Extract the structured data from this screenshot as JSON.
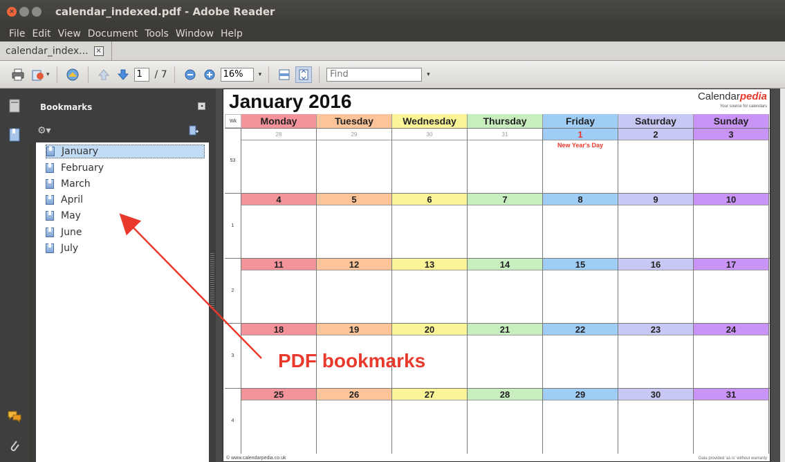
{
  "window": {
    "title": "calendar_indexed.pdf - Adobe Reader",
    "close_glyph": "×",
    "min_glyph": "",
    "max_glyph": ""
  },
  "menu": [
    "File",
    "Edit",
    "View",
    "Document",
    "Tools",
    "Window",
    "Help"
  ],
  "tab": {
    "label": "calendar_index...",
    "close_glyph": "×"
  },
  "toolbar": {
    "page_current": "1",
    "page_total": "/ 7",
    "zoom": "16%",
    "find_placeholder": "Find",
    "icons": [
      "print-icon",
      "share-icon",
      "collaborate-icon",
      "previous-page-icon",
      "next-page-icon",
      "zoom-out-icon",
      "zoom-in-icon",
      "fit-width-icon",
      "fit-page-icon"
    ]
  },
  "sidebar": {
    "title": "Bookmarks",
    "collapse_glyph": "◂",
    "bookmarks": [
      "January",
      "February",
      "March",
      "April",
      "May",
      "June",
      "July"
    ],
    "selected_index": 0
  },
  "calendar": {
    "title": "January 2016",
    "brand_main": "Calendar",
    "brand_accent": "pedia",
    "brand_sub": "Your source for calendars",
    "wk_label": "Wk",
    "days": [
      "Monday",
      "Tuesday",
      "Wednesday",
      "Thursday",
      "Friday",
      "Saturday",
      "Sunday"
    ],
    "day_colors": [
      "#f5939a",
      "#fdc49a",
      "#fbf598",
      "#c8eec0",
      "#9fcdf5",
      "#c8c8f5",
      "#c994f5"
    ],
    "weeks": [
      {
        "wk": "53",
        "dates": [
          "28",
          "29",
          "30",
          "31",
          "1",
          "2",
          "3"
        ],
        "grey": [
          true,
          true,
          true,
          true,
          false,
          false,
          false
        ]
      },
      {
        "wk": "1",
        "dates": [
          "4",
          "5",
          "6",
          "7",
          "8",
          "9",
          "10"
        ],
        "grey": [
          false,
          false,
          false,
          false,
          false,
          false,
          false
        ]
      },
      {
        "wk": "2",
        "dates": [
          "11",
          "12",
          "13",
          "14",
          "15",
          "16",
          "17"
        ],
        "grey": [
          false,
          false,
          false,
          false,
          false,
          false,
          false
        ]
      },
      {
        "wk": "3",
        "dates": [
          "18",
          "19",
          "20",
          "21",
          "22",
          "23",
          "24"
        ],
        "grey": [
          false,
          false,
          false,
          false,
          false,
          false,
          false
        ]
      },
      {
        "wk": "4",
        "dates": [
          "25",
          "26",
          "27",
          "28",
          "29",
          "30",
          "31"
        ],
        "grey": [
          false,
          false,
          false,
          false,
          false,
          false,
          false
        ]
      }
    ],
    "holiday": {
      "week": 0,
      "day": 4,
      "label": "New Year's Day"
    },
    "footer_left": "© www.calendarpedia.co.uk",
    "footer_right": "Data provided 'as is' without warranty"
  },
  "annotation": {
    "label": "PDF bookmarks",
    "color": "#e8392c"
  }
}
